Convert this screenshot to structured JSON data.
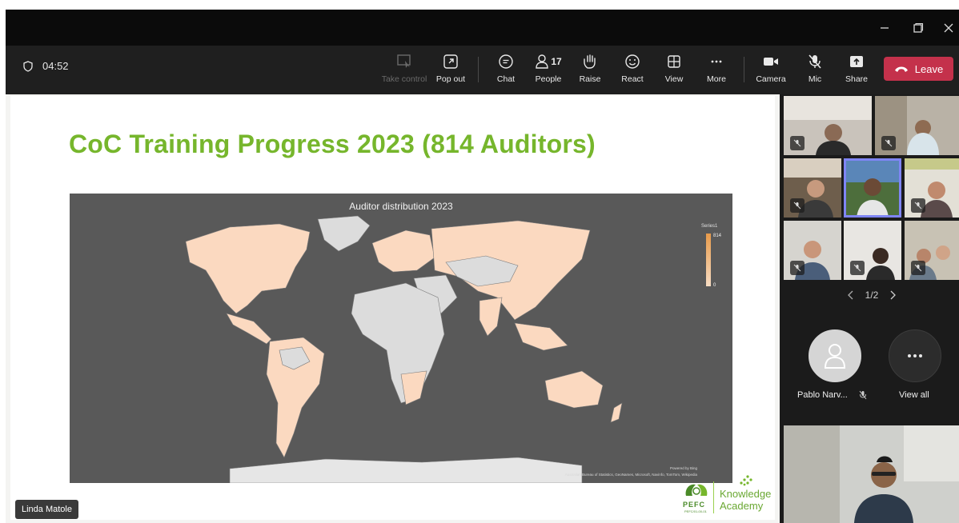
{
  "window": {
    "minimize_icon": "minimize-icon",
    "maximize_icon": "restore-icon",
    "close_icon": "close-icon"
  },
  "toolbar": {
    "timer": "04:52",
    "buttons": {
      "take_control": "Take control",
      "pop_out": "Pop out",
      "chat": "Chat",
      "people": "People",
      "people_count": "17",
      "raise": "Raise",
      "react": "React",
      "view": "View",
      "more": "More",
      "camera": "Camera",
      "mic": "Mic",
      "share": "Share"
    },
    "leave_label": "Leave",
    "leave_color": "#c4314b"
  },
  "slide": {
    "title": "CoC Training Progress 2023 (814 Auditors)",
    "title_color": "#76b62c",
    "map": {
      "title": "Auditor distribution 2023",
      "legend_series": "Series1",
      "legend_max": "814",
      "legend_min": "0",
      "powered_by": "Powered by Bing",
      "credits": "Australian Bureau of Statistics, GeoNames, Microsoft, Navinfo, TomTom, Wikipedia"
    },
    "logos": {
      "pefc": "PEFC",
      "pefc_sub": "PEFC/01-00-01",
      "knowledge": "Knowledge",
      "academy": "Academy"
    }
  },
  "presenter": {
    "name": "Linda Matole"
  },
  "gallery": {
    "page": "1/2",
    "participant_name": "Pablo Narv...",
    "view_all_label": "View all"
  }
}
